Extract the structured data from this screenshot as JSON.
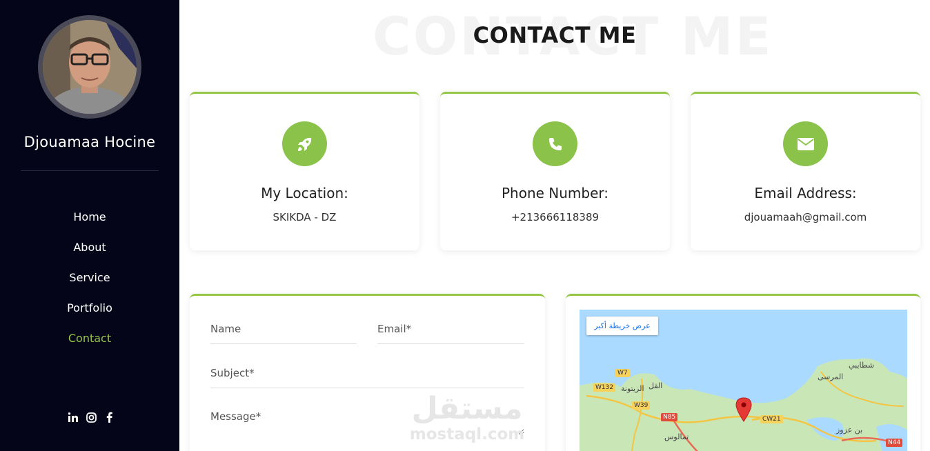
{
  "sidebar": {
    "name": "Djouamaa Hocine",
    "nav": [
      "Home",
      "About",
      "Service",
      "Portfolio",
      "Contact"
    ],
    "active_nav": "Contact",
    "socials": [
      "linkedin-icon",
      "instagram-icon",
      "facebook-icon"
    ]
  },
  "heading": {
    "title": "CONTACT ME",
    "background_text": "CONTACT ME"
  },
  "cards": [
    {
      "icon": "rocket-icon",
      "title": "My Location:",
      "value": "SKIKDA - DZ"
    },
    {
      "icon": "phone-icon",
      "title": "Phone Number:",
      "value": "+213666118389"
    },
    {
      "icon": "envelope-icon",
      "title": "Email Address:",
      "value": "djouamaah@gmail.com"
    }
  ],
  "form": {
    "name_placeholder": "Name",
    "email_placeholder": "Email*",
    "subject_placeholder": "Subject*",
    "message_placeholder": "Message*"
  },
  "watermark": {
    "arabic": "مستقل",
    "latin": "mostaql.com"
  },
  "map": {
    "view_larger": "عرض خريطة أكبر",
    "labels": [
      "شطايبي",
      "المرسى",
      "القل",
      "الزيتونة",
      "تمالوس",
      "بن عزوز"
    ],
    "roads": [
      "W7",
      "W132",
      "W39",
      "N85",
      "CW21",
      "N44"
    ]
  },
  "colors": {
    "accent": "#95c648",
    "sidebar_bg": "#050519",
    "icon_circle": "#8bc34a"
  }
}
